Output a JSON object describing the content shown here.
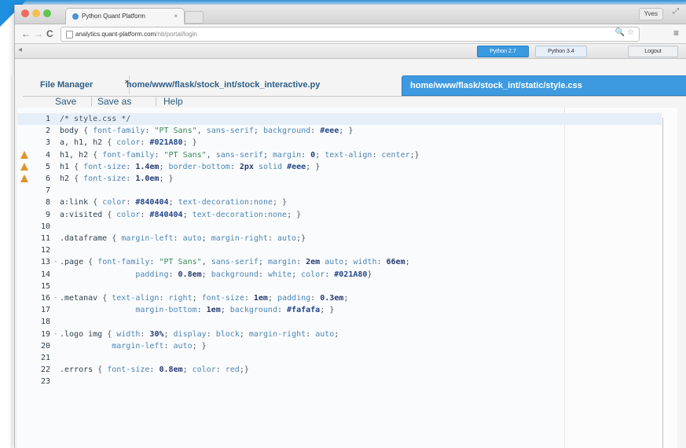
{
  "browser": {
    "tab_title": "Python Quant Platform",
    "tab_close": "×",
    "profile": "Yves",
    "url_host": "analytics.quant-platform.com",
    "url_path": "/nb/portal/login",
    "nav_back": "←",
    "nav_forward": "→",
    "nav_reload": "C",
    "url_right_icons": "🔍 ☆",
    "menu_icon": "≡",
    "fullscreen_icon": "⤢"
  },
  "app_toolbar": {
    "arrow": "◂",
    "python27": "Python 2.7",
    "python34": "Python 3.4",
    "logout": "Logout"
  },
  "editor_tabs": [
    {
      "label": "File Manager",
      "close": "×"
    },
    {
      "label": "home/www/flask/stock_int/stock_interactive.py",
      "close": "×"
    },
    {
      "label": "home/www/flask/stock_int/static/style.css",
      "close": "×"
    }
  ],
  "editor_menu": {
    "save": "Save",
    "save_as": "Save as",
    "help": "Help"
  },
  "code_lines": [
    {
      "n": "1",
      "code": "/* style.css */"
    },
    {
      "n": "2",
      "code": "body { font-family: \"PT Sans\", sans-serif; background: #eee; }"
    },
    {
      "n": "3",
      "code": "a, h1, h2 { color: #021A80; }"
    },
    {
      "n": "4",
      "code": "h1, h2 { font-family: \"PT Sans\", sans-serif; margin: 0; text-align: center;}"
    },
    {
      "n": "5",
      "code": "h1 { font-size: 1.4em; border-bottom: 2px solid #eee; }"
    },
    {
      "n": "6",
      "code": "h2 { font-size: 1.0em; }"
    },
    {
      "n": "7",
      "code": ""
    },
    {
      "n": "8",
      "code": "a:link { color: #840404; text-decoration:none; }"
    },
    {
      "n": "9",
      "code": "a:visited { color: #840404; text-decoration:none; }"
    },
    {
      "n": "10",
      "code": ""
    },
    {
      "n": "11",
      "code": ".dataframe { margin-left: auto; margin-right: auto;}"
    },
    {
      "n": "12",
      "code": ""
    },
    {
      "n": "13",
      "code": ".page { font-family: \"PT Sans\", sans-serif; margin: 2em auto; width: 66em;"
    },
    {
      "n": "14",
      "code": "                padding: 0.8em; background: white; color: #021A80}"
    },
    {
      "n": "15",
      "code": ""
    },
    {
      "n": "16",
      "code": ".metanav { text-align: right; font-size: 1em; padding: 0.3em;"
    },
    {
      "n": "17",
      "code": "                margin-bottom: 1em; background: #fafafa; }"
    },
    {
      "n": "18",
      "code": ""
    },
    {
      "n": "19",
      "code": ".logo img { width: 30%; display: block; margin-right: auto;"
    },
    {
      "n": "20",
      "code": "           margin-left: auto; }"
    },
    {
      "n": "21",
      "code": ""
    },
    {
      "n": "22",
      "code": ".errors { font-size: 0.8em; color: red;}"
    },
    {
      "n": "23",
      "code": ""
    }
  ],
  "warning_lines": [
    "4",
    "5",
    "6"
  ],
  "fold_lines": [
    "13",
    "16",
    "19"
  ],
  "colors": {
    "accent": "#3d9ae0",
    "warning": "#e0952c"
  }
}
